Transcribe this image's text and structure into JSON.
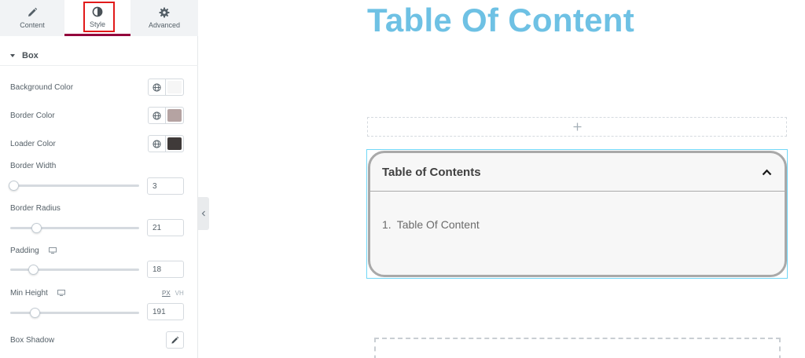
{
  "panel": {
    "tabs": [
      {
        "label": "Content",
        "icon": "pencil-icon"
      },
      {
        "label": "Style",
        "icon": "half-circle-icon"
      },
      {
        "label": "Advanced",
        "icon": "gear-icon"
      }
    ],
    "active_tab": "Style",
    "section": {
      "title": "Box"
    },
    "background_color": {
      "label": "Background Color",
      "swatch": "#f6f6f6"
    },
    "border_color": {
      "label": "Border Color",
      "swatch": "#b5a3a2"
    },
    "loader_color": {
      "label": "Loader Color",
      "swatch": "#3f3a39"
    },
    "border_width": {
      "label": "Border Width",
      "value": "3"
    },
    "border_radius": {
      "label": "Border Radius",
      "value": "21"
    },
    "padding": {
      "label": "Padding",
      "value": "18"
    },
    "min_height": {
      "label": "Min Height",
      "value": "191",
      "units": [
        "PX",
        "VH"
      ],
      "active_unit": "PX"
    },
    "box_shadow": {
      "label": "Box Shadow"
    }
  },
  "canvas": {
    "page_title": "Table Of Content",
    "toc": {
      "header_title": "Table of Contents",
      "items": [
        {
          "number": "1.",
          "text": "Table Of Content"
        }
      ]
    }
  },
  "colors": {
    "accent": "#93003c",
    "title_blue": "#6ec1e4",
    "highlight_red": "#e11a1a",
    "toc_border": "#a9a9a9"
  }
}
